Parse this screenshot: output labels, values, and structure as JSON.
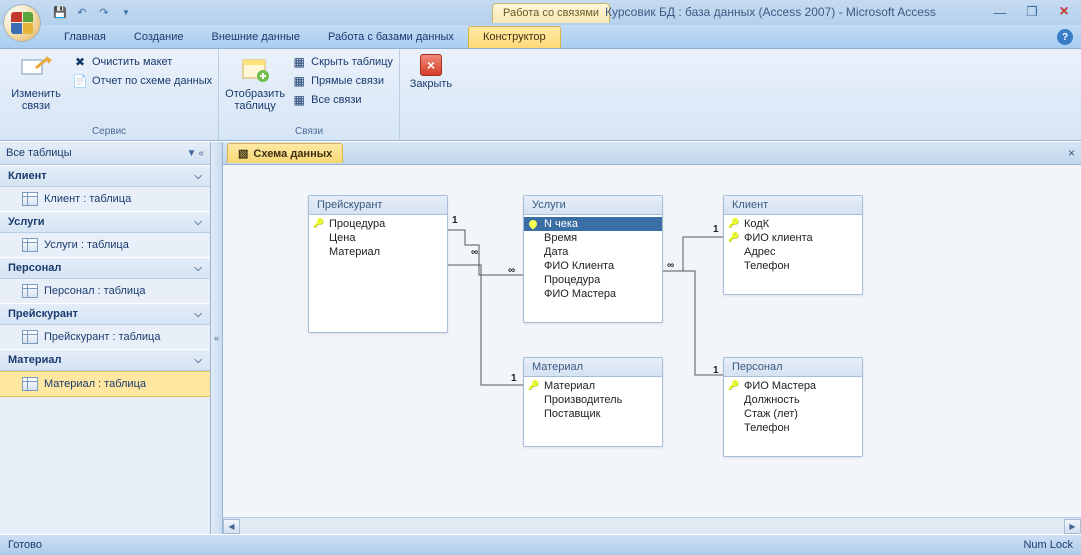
{
  "window": {
    "ctx_group": "Работа со связями",
    "title": "Курсовик БД : база данных (Access 2007) - Microsoft Access"
  },
  "tabs": {
    "home": "Главная",
    "create": "Создание",
    "external": "Внешние данные",
    "dbtools": "Работа с базами данных",
    "design": "Конструктор"
  },
  "ribbon": {
    "edit_rel": "Изменить\nсвязи",
    "clear_layout": "Очистить макет",
    "rel_report": "Отчет по схеме данных",
    "group_tools": "Сервис",
    "show_table": "Отобразить\nтаблицу",
    "hide_table": "Скрыть таблицу",
    "direct_rel": "Прямые связи",
    "all_rel": "Все связи",
    "group_rel": "Связи",
    "close": "Закрыть"
  },
  "nav": {
    "header": "Все таблицы",
    "groups": [
      {
        "name": "Клиент",
        "item": "Клиент : таблица"
      },
      {
        "name": "Услуги",
        "item": "Услуги : таблица"
      },
      {
        "name": "Персонал",
        "item": "Персонал : таблица"
      },
      {
        "name": "Прейскурант",
        "item": "Прейскурант : таблица"
      },
      {
        "name": "Материал",
        "item": "Материал : таблица"
      }
    ]
  },
  "doc_tab": "Схема данных",
  "tables": {
    "price": {
      "title": "Прейскурант",
      "f0": "Процедура",
      "f1": "Цена",
      "f2": "Материал"
    },
    "services": {
      "title": "Услуги",
      "f0": "N чека",
      "f1": "Время",
      "f2": "Дата",
      "f3": "ФИО Клиента",
      "f4": "Процедура",
      "f5": "ФИО Мастера"
    },
    "client": {
      "title": "Клиент",
      "f0": "КодК",
      "f1": "ФИО клиента",
      "f2": "Адрес",
      "f3": "Телефон"
    },
    "material": {
      "title": "Материал",
      "f0": "Материал",
      "f1": "Производитель",
      "f2": "Поставщик"
    },
    "staff": {
      "title": "Персонал",
      "f0": "ФИО Мастера",
      "f1": "Должность",
      "f2": "Стаж (лет)",
      "f3": "Телефон"
    }
  },
  "status": {
    "ready": "Готово",
    "numlock": "Num Lock"
  }
}
